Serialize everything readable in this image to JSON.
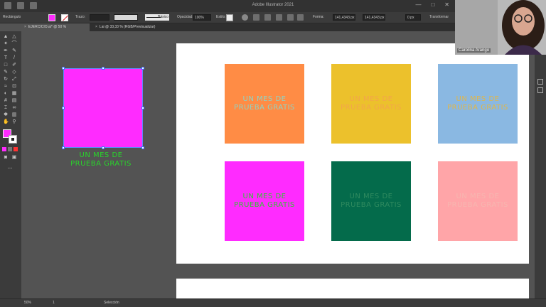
{
  "app": {
    "title": "Adobe Illustrator 2021",
    "window_controls": [
      "—",
      "□",
      "✕"
    ]
  },
  "control_bar": {
    "object_label": "Rectángulo",
    "trazo_label": "Trazo:",
    "stroke_style_label": "Básico",
    "opacity_label": "Opacidad:",
    "opacity_value": "100%",
    "style_label": "Estilo:",
    "forma_label": "Forma:",
    "width_value": "141,4343 px",
    "height_value": "141,4343 px",
    "corner_value": "0 px",
    "transform_label": "Transformar"
  },
  "tabs": [
    {
      "close": "×",
      "label": "EJERCICIO.ai* @ 50 % (RGB/Previsualizar)"
    },
    {
      "close": "×",
      "label": "Lai @ 33,33 % (RGB/Previsualizar)"
    }
  ],
  "squares": [
    {
      "text": "UN MES DE PRUEBA GRATIS",
      "bg": "#ff8c45",
      "color": "#8fd3c4"
    },
    {
      "text": "UN MES DE PRUEBA GRATIS",
      "bg": "#ecc12c",
      "color": "#f3a64a"
    },
    {
      "text": "UN MES DE PRUEBA GRATIS",
      "bg": "#8ab8e2",
      "color": "#e0b64a"
    },
    {
      "text": "UN MES DE PRUEBA GRATIS",
      "bg": "#ff2bff",
      "color": "#37c237"
    },
    {
      "text": "UN MES DE PRUEBA GRATIS",
      "bg": "#046b4b",
      "color": "#2f8a5f"
    },
    {
      "text": "UN MES DE PRUEBA GRATIS",
      "bg": "#ffa5a8",
      "color": "#f7b6b0"
    }
  ],
  "loose_text": "UN MES DE PRUEBA GRATIS",
  "colors": {
    "selected_fill": "#ff2bff",
    "loose_text": "#29d42b",
    "selection_handles": "#3d6eff"
  },
  "status_bar": {
    "zoom": "50%",
    "page": "1",
    "tool": "Selección"
  },
  "webcam": {
    "name": "Carolina Arango"
  }
}
